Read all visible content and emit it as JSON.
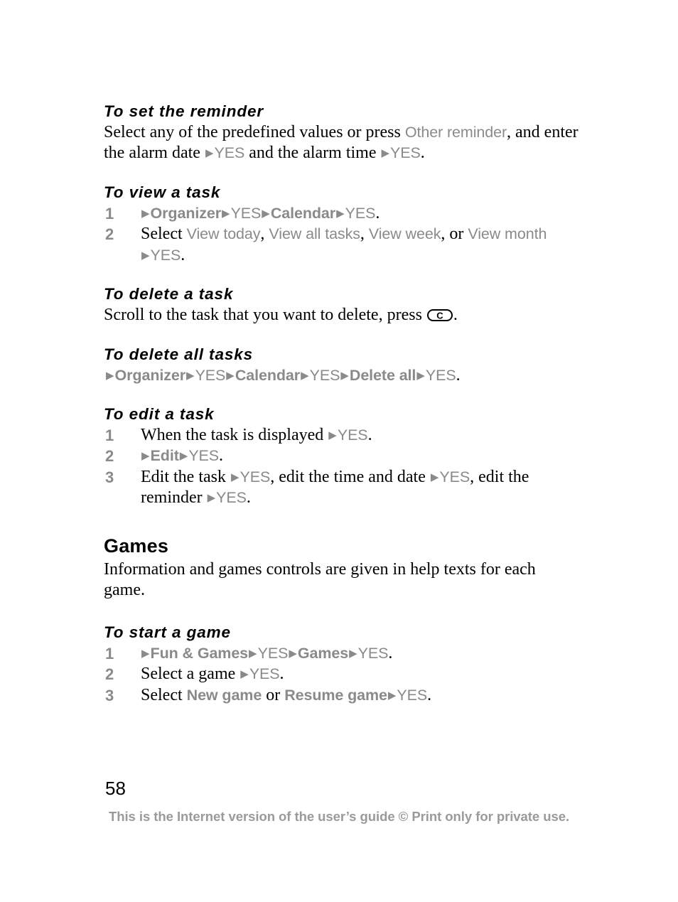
{
  "document": {
    "page_number": "58",
    "footer_text": "This is the Internet version of the user’s guide © Print only for private use.",
    "colors": {
      "ui_term_gray": "#8a8a8a",
      "footer_gray": "#9a9a9a",
      "body_black": "#000000"
    },
    "glyphs": {
      "arrow": "▶",
      "clear_key": "C"
    }
  },
  "sections": {
    "set_reminder": {
      "heading": "To set the reminder",
      "line1_a": "Select any of the predefined values or press ",
      "line1_ui": "Other reminder",
      "line1_b": ", and enter the alarm date ",
      "line1_yes1": "YES",
      "line1_c": " and the alarm time ",
      "line1_yes2": "YES",
      "line1_end": "."
    },
    "view_task": {
      "heading": "To view a task",
      "step1": {
        "num": "1",
        "ui_organizer": "Organizer",
        "yes1": "YES",
        "ui_calendar": "Calendar",
        "yes2": "YES",
        "end": "."
      },
      "step2": {
        "num": "2",
        "lead": "Select ",
        "ui_view_today": "View today",
        "sep1": ", ",
        "ui_view_all_tasks": "View all tasks",
        "sep2": ", ",
        "ui_view_week": "View week",
        "sep3": ", or ",
        "ui_view_month": "View month",
        "yes": "YES",
        "end": "."
      }
    },
    "delete_task": {
      "heading": "To delete a task",
      "text_a": "Scroll to the task that you want to delete, press ",
      "key": "C",
      "text_b": "."
    },
    "delete_all_tasks": {
      "heading": "To delete all tasks",
      "ui_organizer": "Organizer",
      "yes1": "YES",
      "ui_calendar": "Calendar",
      "yes2": "YES",
      "ui_delete_all": "Delete all",
      "yes3": "YES",
      "end": "."
    },
    "edit_task": {
      "heading": "To edit a task",
      "step1": {
        "num": "1",
        "lead": "When the task is displayed ",
        "yes": "YES",
        "end": "."
      },
      "step2": {
        "num": "2",
        "ui_edit": "Edit",
        "yes": "YES",
        "end": "."
      },
      "step3": {
        "num": "3",
        "part_a": "Edit the task ",
        "yes1": "YES",
        "part_b": ", edit the time and date ",
        "yes2": "YES",
        "part_c": ", edit the reminder ",
        "yes3": "YES",
        "end": "."
      }
    },
    "games": {
      "heading": "Games",
      "intro": "Information and games controls are given in help texts for each game."
    },
    "start_game": {
      "heading": "To start a game",
      "step1": {
        "num": "1",
        "ui_fun_games": "Fun & Games",
        "yes1": "YES",
        "ui_games": "Games",
        "yes2": "YES",
        "end": "."
      },
      "step2": {
        "num": "2",
        "lead": "Select a game ",
        "yes": "YES",
        "end": "."
      },
      "step3": {
        "num": "3",
        "lead": "Select ",
        "ui_new_game": "New game",
        "sep": " or ",
        "ui_resume_game": "Resume game",
        "yes": "YES",
        "end": "."
      }
    }
  }
}
